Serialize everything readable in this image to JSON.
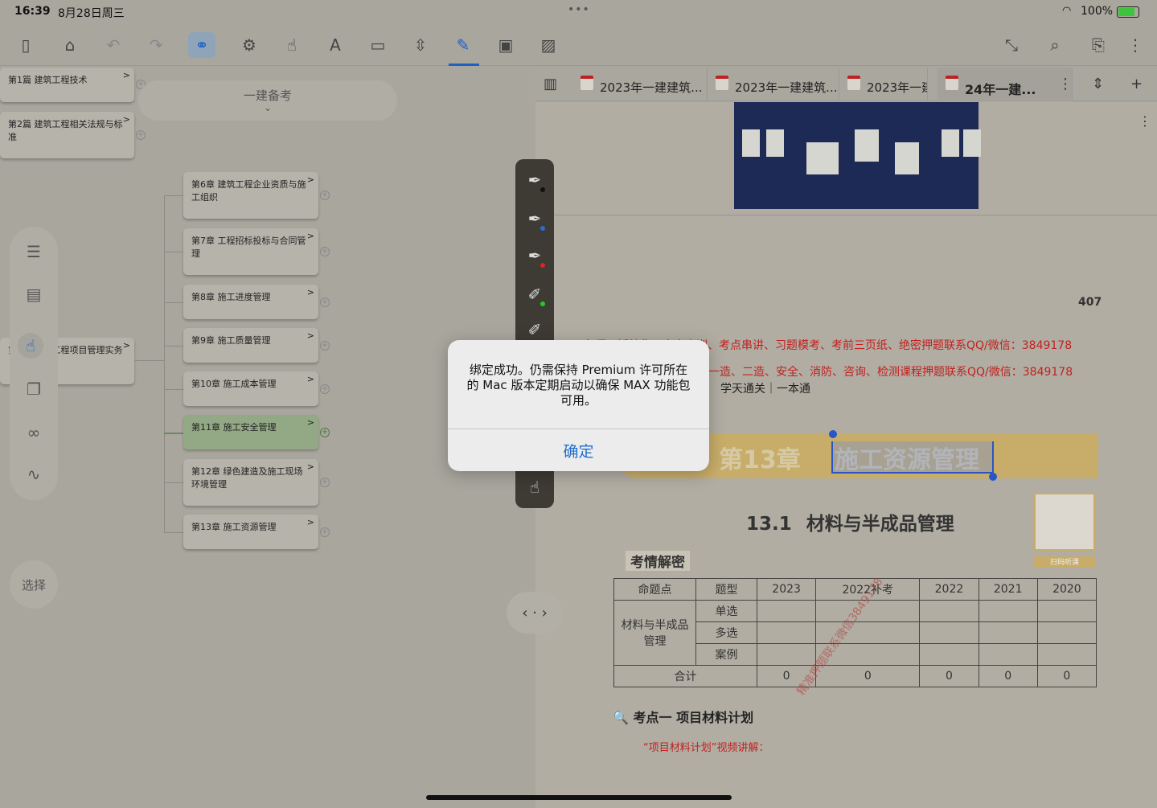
{
  "status_bar": {
    "time": "16:39",
    "date": "8月28日周三",
    "dots": "•••",
    "battery": "100%"
  },
  "toolbar": {
    "items": [
      "sidebar-icon",
      "library-icon",
      "undo-icon",
      "redo-icon",
      "mindmap-icon",
      "settings-cycle-icon",
      "hand-icon",
      "text-underline-icon",
      "crop-icon",
      "expand-icon",
      "pen-icon",
      "textbox-icon",
      "image-icon",
      "collapse-icon",
      "search-doc-icon",
      "bookmark-icon",
      "more-icon"
    ]
  },
  "mindmap": {
    "root": "一建备考",
    "parts": [
      {
        "label": "第1篇 建筑工程技术"
      },
      {
        "label": "第2篇 建筑工程相关法规与标准"
      },
      {
        "label": "第3篇 建筑工程项目管理实务"
      }
    ],
    "chapters": [
      {
        "label": "第6章 建筑工程企业资质与施工组织"
      },
      {
        "label": "第7章 工程招标投标与合同管理"
      },
      {
        "label": "第8章 施工进度管理"
      },
      {
        "label": "第9章 施工质量管理"
      },
      {
        "label": "第10章 施工成本管理"
      },
      {
        "label": "第11章 施工安全管理"
      },
      {
        "label": "第12章 绿色建造及施工现场环境管理"
      },
      {
        "label": "第13章 施工资源管理"
      }
    ],
    "chevron": ">",
    "plus": "+"
  },
  "dock": {
    "select_label": "选择"
  },
  "tabs": [
    {
      "label": "2023年一建建筑..."
    },
    {
      "label": "2023年一建建筑..."
    },
    {
      "label": "2023年一建"
    },
    {
      "label": "24年一建..."
    }
  ],
  "doc": {
    "page_number": "407",
    "ad_line_1": "备师面授精华、内含内训、考点串讲、习题模考、考前三页纸、绝密押题联系QQ/微信：3849178",
    "ad_line_2": "一造、二造、安全、消防、咨询、检测课程押题联系QQ/微信：3849178",
    "ad_line_3": "学天通关｜一本通",
    "chapter_num": "第13章",
    "chapter_title": "施工资源管理",
    "section_num": "13.1",
    "section_title": "材料与半成品管理",
    "kaoqing": "考情解密",
    "qr_label": "扫码听课",
    "table": {
      "headers": [
        "命题点",
        "题型",
        "2023",
        "2022补考",
        "2022",
        "2021",
        "2020"
      ],
      "row_label": "材料与半成品管理",
      "types": [
        "单选",
        "多选",
        "案例"
      ],
      "total_label": "合计",
      "totals": [
        "0",
        "0",
        "0",
        "0",
        "0"
      ]
    },
    "watermark": "精准押题联系微信3849178",
    "kaodian": "考点一  项目材料计划",
    "video": "“项目材料计划”视频讲解："
  },
  "alert": {
    "message": "绑定成功。仍需保持 Premium 许可所在的 Mac 版本定期启动以确保 MAX 功能包可用。",
    "ok": "确定"
  }
}
